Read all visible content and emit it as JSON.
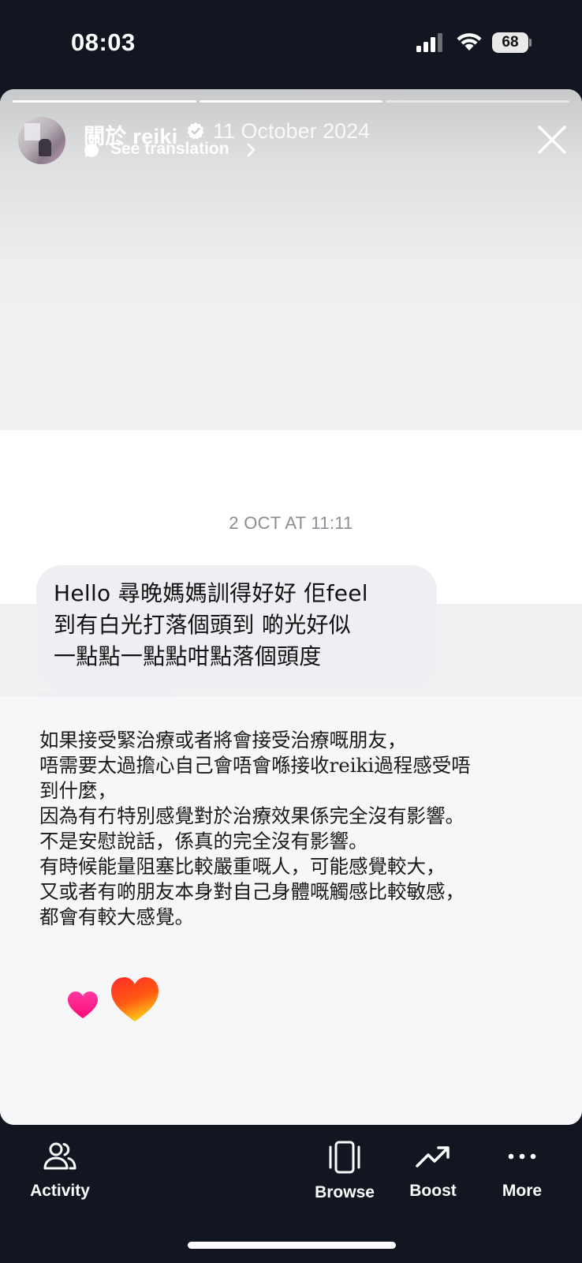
{
  "status_bar": {
    "time": "08:03",
    "battery_level": "68",
    "icons": [
      "signal-icon",
      "wifi-icon",
      "battery-icon"
    ]
  },
  "story": {
    "account_name": "關於 reiki",
    "verified": true,
    "date": "11 October 2024",
    "see_translation": "See translation",
    "progress_segments_total": 3,
    "progress_segments_done": 2
  },
  "dm_screenshot": {
    "timestamp": "2 OCT AT 11:11",
    "message_lines": [
      "Hello 尋晚媽媽訓得好好 佢feel",
      "到有白光打落個頭到 啲光好似",
      "一點點一點點咁點落個頭度"
    ]
  },
  "note": {
    "lines": [
      "如果接受緊治療或者將會接受治療嘅朋友，",
      "唔需要太過擔心自己會唔會喺接收reiki過程感受唔",
      "到什麼，",
      "因為有冇特別感覺對於治療效果係完全沒有影響。",
      "不是安慰說話，係真的完全沒有影響。",
      "有時候能量阻塞比較嚴重嘅人，可能感覺較大，",
      "又或者有啲朋友本身對自己身體嘅觸感比較敏感，",
      "都會有較大感覺。"
    ]
  },
  "stickers": [
    "heart-pink-icon",
    "heart-orange-icon"
  ],
  "bottom_nav": {
    "activity": "Activity",
    "browse": "Browse",
    "boost": "Boost",
    "more": "More"
  },
  "colors": {
    "background": "#121620",
    "bubble": "#efeff3",
    "heart_pink": "#ff1f8e",
    "heart_orange": "#ff5a1f"
  }
}
